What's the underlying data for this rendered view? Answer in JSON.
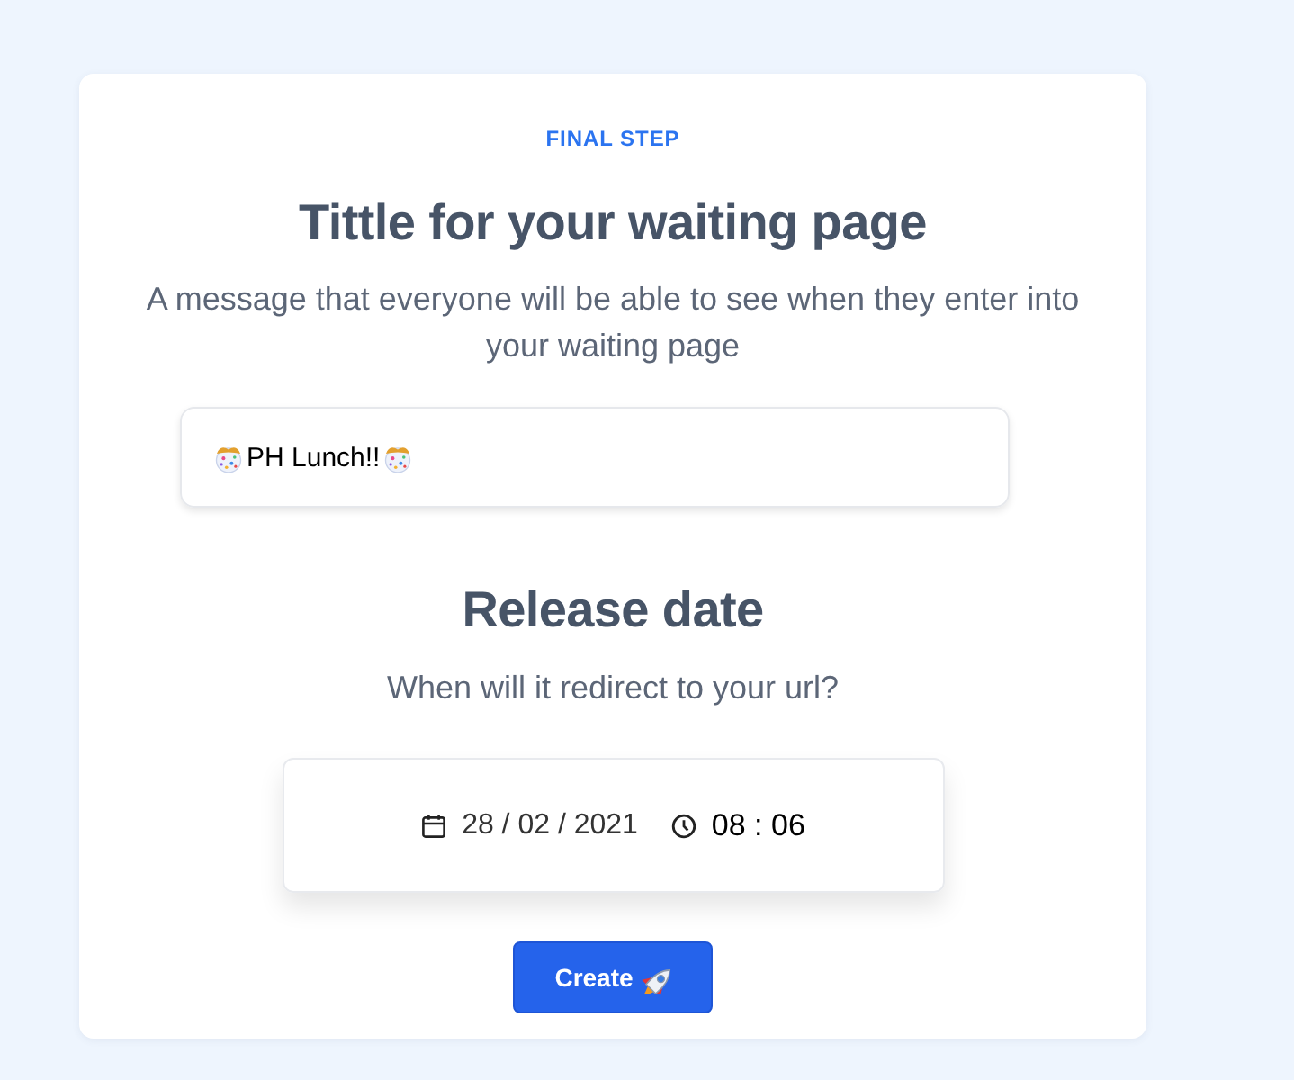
{
  "step_label": "FINAL STEP",
  "title_section": {
    "heading": "Tittle for your waiting page",
    "description": "A message that everyone will be able to see when they enter into your waiting page"
  },
  "title_field": {
    "value": "PH Lunch!!"
  },
  "release_section": {
    "heading": "Release date",
    "description": "When will it redirect to your url?"
  },
  "datetime_field": {
    "date": "28 / 02 / 2021",
    "time": "08 : 06"
  },
  "button": {
    "label": "Create"
  }
}
